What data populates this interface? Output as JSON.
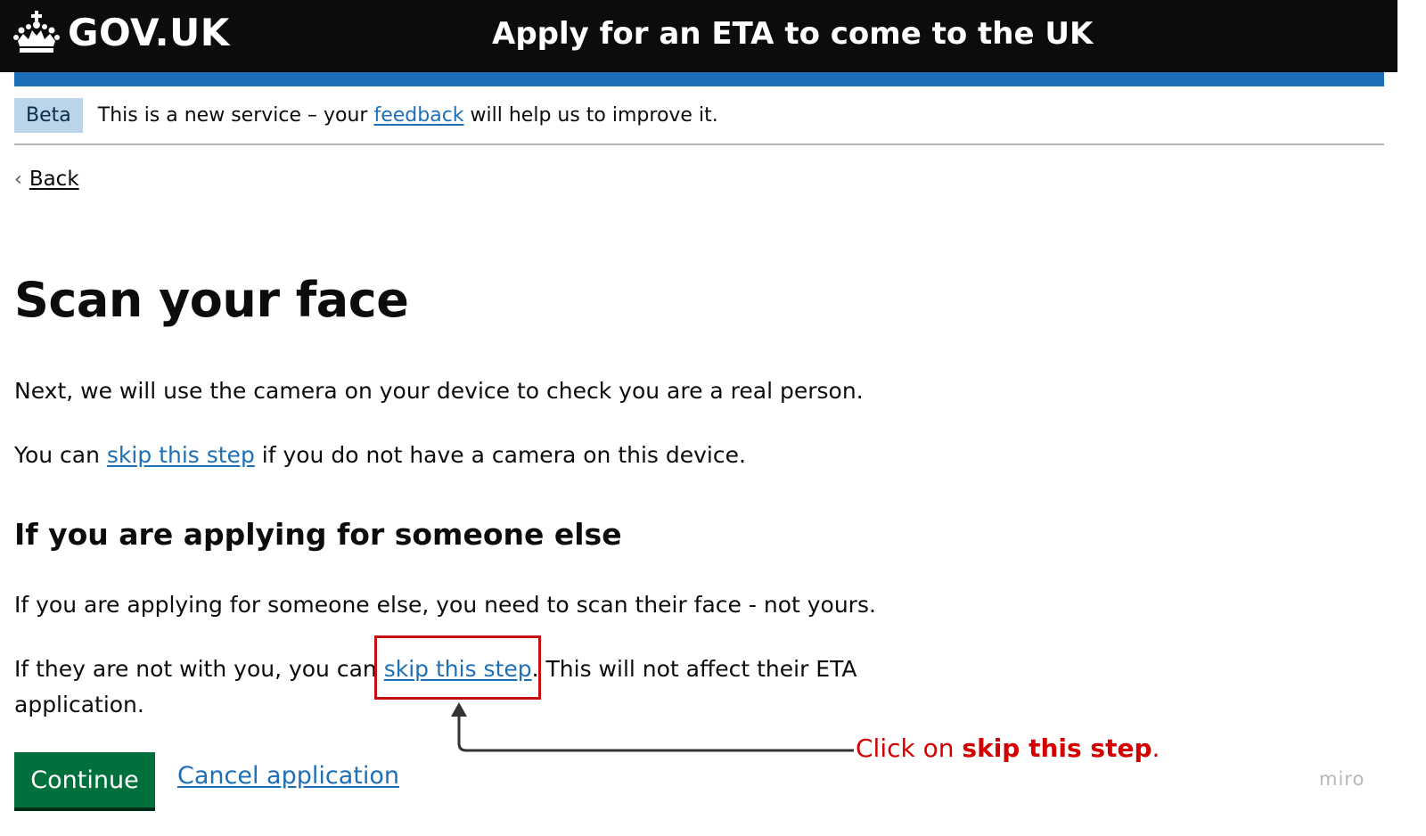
{
  "header": {
    "logo_text": "GOV.UK",
    "service_name": "Apply for an ETA to come to the UK"
  },
  "phase_banner": {
    "tag": "Beta",
    "text_before": "This is a new service – your ",
    "link": "feedback",
    "text_after": " will help us to improve it."
  },
  "back_link": {
    "label": "Back"
  },
  "page": {
    "title": "Scan your face",
    "para1": "Next, we will use the camera on your device to check you are a real person.",
    "para2_before": "You can ",
    "para2_link": "skip this step",
    "para2_after": " if you do not have a camera on this device.",
    "subheading": "If you are applying for someone else",
    "para3": "If you are applying for someone else, you need to scan their face - not yours.",
    "para4_before": "If they are not with you, you can ",
    "para4_link": "skip this step",
    "para4_after": ". This will not affect their ETA",
    "para4_line2": "application."
  },
  "annotation": {
    "prefix": "Click on ",
    "bold": "skip this step",
    "suffix": "."
  },
  "actions": {
    "continue_label": "Continue",
    "cancel_label": "Cancel application"
  },
  "watermark": "miro",
  "colors": {
    "header_bg": "#0b0c0c",
    "blue_bar": "#1d70b8",
    "link": "#1d70b8",
    "button": "#00703c",
    "annotation": "#d40000"
  }
}
